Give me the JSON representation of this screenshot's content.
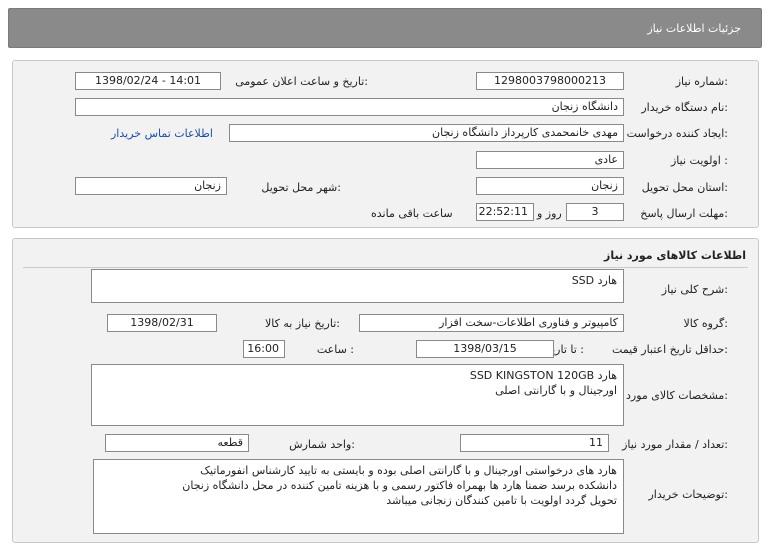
{
  "header": {
    "title": "جزئیات اطلاعات نیاز"
  },
  "info": {
    "need_number_label": "شماره نیاز:",
    "need_number": "1298003798000213",
    "announce_label": "تاریخ و ساعت اعلان عمومی:",
    "announce_value": "1398/02/24 - 14:01",
    "buyer_org_label": "نام دستگاه خریدار:",
    "buyer_org": "دانشگاه زنجان",
    "requester_label": "ایجاد کننده درخواست:",
    "requester": "مهدی خانمحمدی کارپرداز دانشگاه زنجان",
    "contact_link": "اطلاعات تماس خریدار",
    "priority_label": "اولویت نیاز :",
    "priority": "عادی",
    "province_label": "استان محل تحویل:",
    "province": "زنجان",
    "city_label": "شهر محل تحویل:",
    "city": "زنجان",
    "deadline_label": "مهلت ارسال پاسخ:",
    "days": "3",
    "days_suffix": "روز و",
    "time_left": "22:52:11",
    "time_left_suffix": "ساعت باقی مانده"
  },
  "goods": {
    "section_title": "اطلاعات کالاهای مورد نیاز",
    "summary_label": "شرح کلی نیاز:",
    "summary": "هارد SSD",
    "group_label": "گروه کالا:",
    "group": "کامپیوتر و فناوری اطلاعات-سخت افزار",
    "need_date_label": "تاریخ نیاز به کالا:",
    "need_date": "1398/02/31",
    "validity_label": "حداقل تاریخ اعتبار قیمت:",
    "validity_to_label": "تا تاریخ :",
    "validity_date": "1398/03/15",
    "validity_time_label": "ساعت :",
    "validity_time": "16:00",
    "specs_label": "مشخصات کالای مورد نیاز:",
    "specs_lines": [
      "هارد  SSD KINGSTON 120GB",
      "اورجینال و با گارانتی اصلی"
    ],
    "qty_label": "تعداد / مقدار مورد نیاز:",
    "qty": "11",
    "unit_label": "واحد شمارش:",
    "unit": "قطعه",
    "notes_label": "توضیحات خریدار:",
    "notes_lines": [
      "هارد های درخواستی اورجینال و با گارانتی اصلی بوده و بایستی به تایید کارشناس انفورماتیک",
      "دانشکده برسد ضمنا هارد ها بهمراه فاکتور رسمی و با هزینه تامین کننده در محل دانشگاه زنجان",
      "تحویل گردد اولویت با تامین کنندگان زنجانی میباشد"
    ]
  }
}
